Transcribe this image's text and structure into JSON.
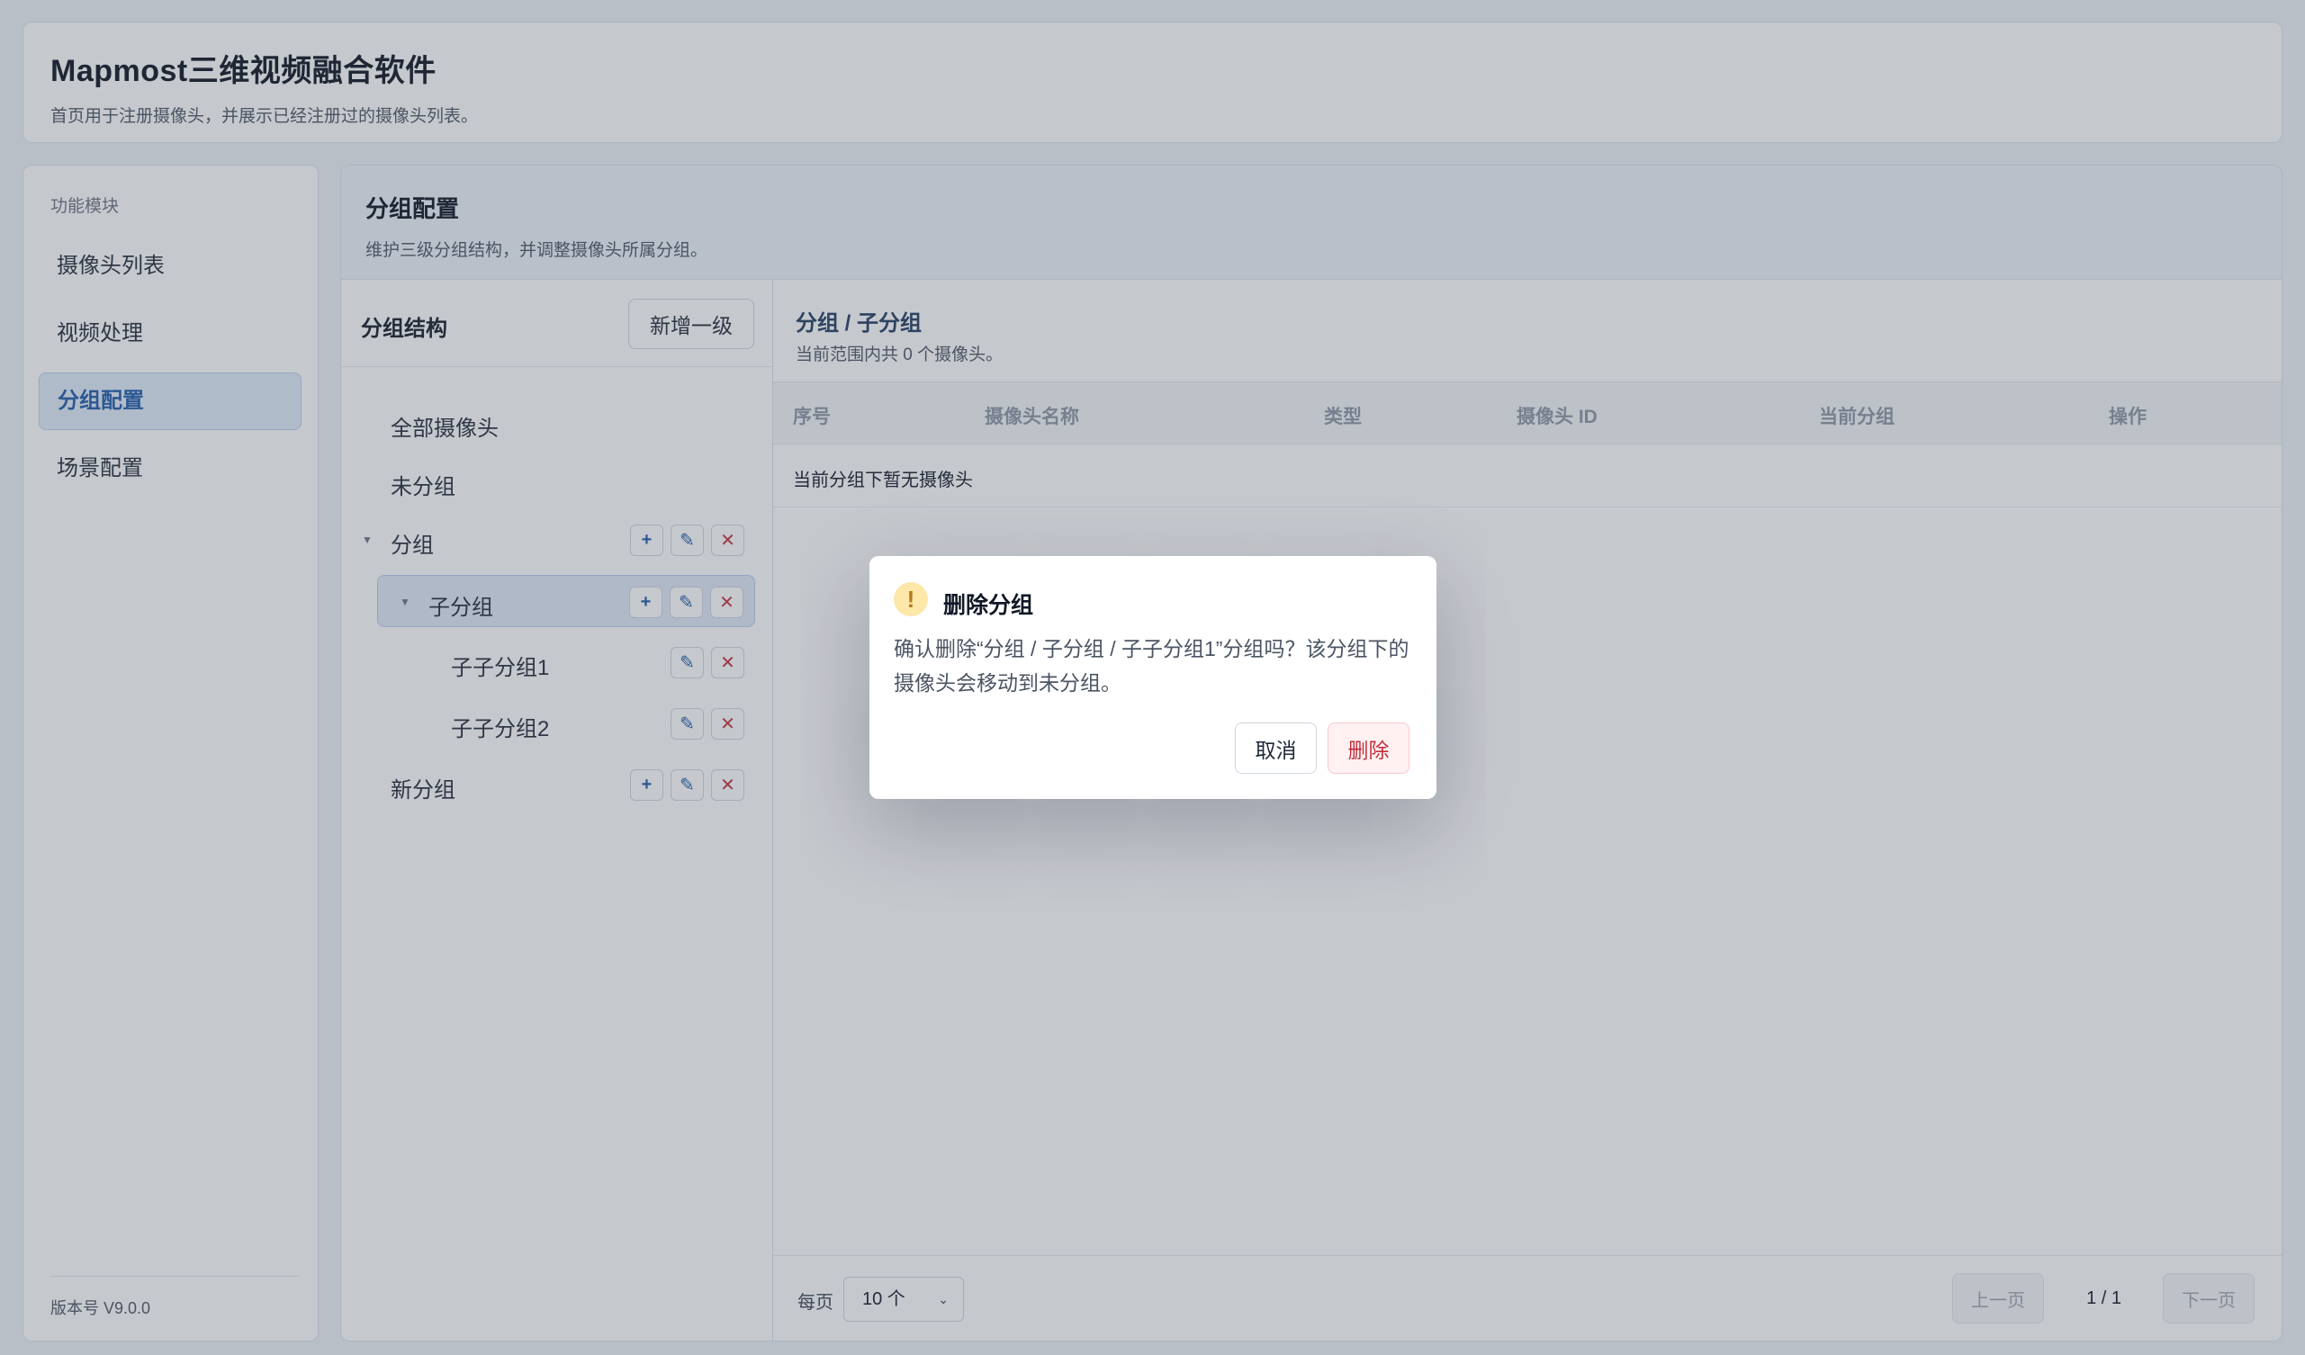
{
  "header": {
    "title": "Mapmost三维视频融合软件",
    "subtitle": "首页用于注册摄像头，并展示已经注册过的摄像头列表。"
  },
  "sidebar": {
    "section_label": "功能模块",
    "items": [
      {
        "label": "摄像头列表"
      },
      {
        "label": "视频处理"
      },
      {
        "label": "分组配置"
      },
      {
        "label": "场景配置"
      }
    ],
    "active_item": "分组配置",
    "version": "版本号 V9.0.0"
  },
  "main": {
    "title": "分组配置",
    "subtitle": "维护三级分组结构，并调整摄像头所属分组。"
  },
  "tree": {
    "title": "分组结构",
    "add_top_label": "新增一级",
    "nodes": [
      {
        "label": "全部摄像头",
        "level": 0
      },
      {
        "label": "未分组",
        "level": 0
      },
      {
        "label": "分组",
        "level": 0,
        "expanded": true
      },
      {
        "label": "子分组",
        "level": 1,
        "expanded": true,
        "selected": true
      },
      {
        "label": "子子分组1",
        "level": 2
      },
      {
        "label": "子子分组2",
        "level": 2
      },
      {
        "label": "新分组",
        "level": 0
      }
    ],
    "icons": {
      "add": "plus-icon",
      "edit": "pencil-icon",
      "delete": "close-icon",
      "expand": "caret-down-icon"
    }
  },
  "content": {
    "breadcrumb": "分组 / 子分组",
    "summary": "当前范围内共 0 个摄像头。",
    "columns": [
      "序号",
      "摄像头名称",
      "类型",
      "摄像头 ID",
      "当前分组",
      "操作"
    ],
    "empty_text": "当前分组下暂无摄像头"
  },
  "pager": {
    "per_page_label": "每页",
    "per_page_value": "10 个",
    "prev_label": "上一页",
    "page_info": "1 / 1",
    "next_label": "下一页"
  },
  "dialog": {
    "icon": "warning-icon",
    "title": "删除分组",
    "message": "确认删除“分组 / 子分组 / 子子分组1”分组吗？该分组下的摄像头会移动到未分组。",
    "cancel_label": "取消",
    "confirm_label": "删除"
  },
  "colors": {
    "accent": "#1e5aa8",
    "danger": "#c2303c",
    "warning": "#fde7a9",
    "overlay": "rgba(75,85,99,0.32)"
  }
}
